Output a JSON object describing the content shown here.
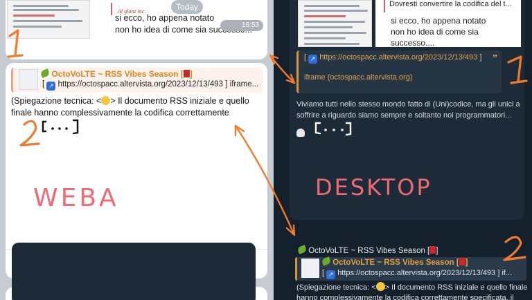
{
  "web": {
    "date_badge": "Today",
    "top_quote_label": "Al glanz inc:",
    "top_message": [
      "si ecco, ho appena notato",
      "non ho idea di come sia successo..."
    ],
    "top_time": "16:53",
    "reply_title": "OctoVoLTE ~ RSS Vibes Season [",
    "reply_title_end": "]",
    "reply_link_prefix": "[",
    "reply_link": "https://octospacc.altervista.org/2023/12/13/493",
    "reply_link_suffix": "] iframe...",
    "body_prefix": "(Spiegazione tecnica: <",
    "body_rest": "> Il documento RSS iniziale e quello finale hanno complessivamente la codifica correttamente"
  },
  "desktop": {
    "quote_text": "Dovresti convertire la codifica del t...",
    "quote_label": "Al glanz inc:",
    "message": [
      "si ecco, ho appena notato",
      "non ho idea di come sia successo...."
    ],
    "card_link_prefix": "[",
    "card_link": "https://octospacc.altervista.org/2023/12/13/493",
    "card_link_suffix": "]",
    "card_quote_mark": "”",
    "card_iframe": "iframe (octospacc.altervista.org)",
    "body": "Viviamo tutti nello stesso mondo fatto di (Uni)codice, ma gli unici a soffrire a riguardo siamo sempre e soltanto noi programmatori...",
    "msg2_title": "OctoVoLTE ~ RSS Vibes Season [",
    "msg2_title_end": "]",
    "msg2_reply_title": "OctoVoLTE ~ RSS Vibes Season [",
    "msg2_reply_title_end": "]",
    "msg2_link_prefix": "[",
    "msg2_link": "https://octospacc.altervista.org/2023/12/13/493",
    "msg2_link_suffix": "] if...",
    "msg2_body_prefix": "(Spiegazione tecnica: <",
    "msg2_body_rest": "> Il documento RSS iniziale e quello finale hanno complessivamente la codifica correttamente specificata, il"
  },
  "annotations": {
    "label_web": "WEBA",
    "label_desktop": "DESKTOP",
    "num_1": "1",
    "num_2": "2"
  },
  "icons": [
    "external-link-icon",
    "book-icon",
    "leaf-icon",
    "emoji-icon",
    "skull-icon"
  ],
  "colors": {
    "ink": "#f07a2e",
    "ink_pink": "#f06a76",
    "web_bg": "#c7ccd3",
    "desktop_bg": "#14202c"
  }
}
